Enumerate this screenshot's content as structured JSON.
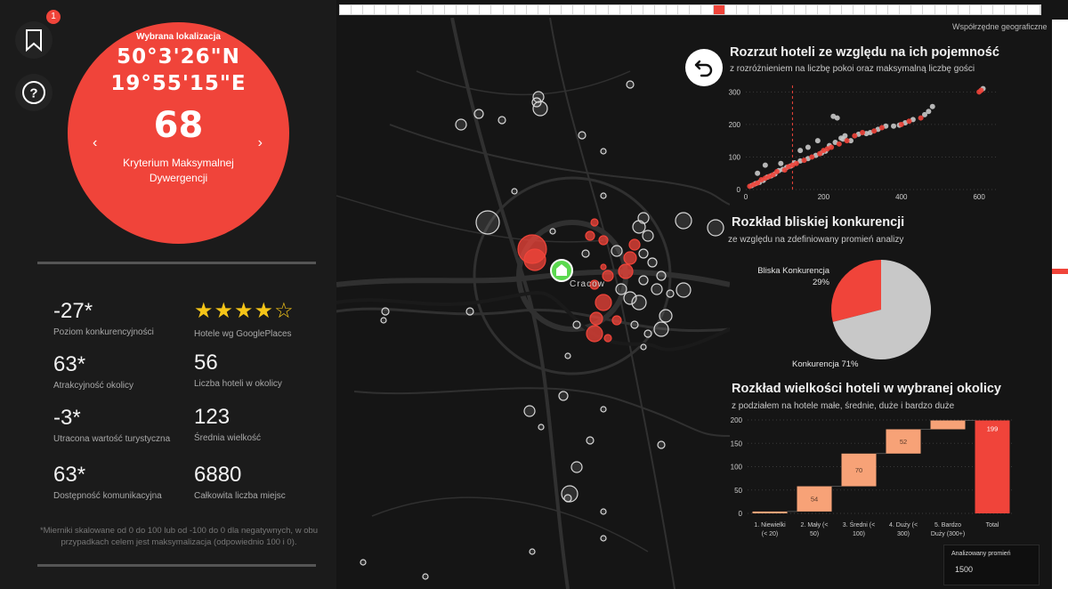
{
  "nav": {
    "badge_count": "1"
  },
  "location": {
    "label": "Wybrana lokalizacja",
    "lat": "50°3'26\"N",
    "lon": "19°55'15\"E",
    "score": "68",
    "criterion": "Kryterium Maksymalnej Dywergencji",
    "prev_icon": "‹",
    "next_icon": "›"
  },
  "kpis": [
    {
      "value": "-27*",
      "label": "Poziom konkurencyjności"
    },
    {
      "value": "63*",
      "label": "Atrakcyjność okolicy"
    },
    {
      "value": "-3*",
      "label": "Utracona wartość turystyczna"
    },
    {
      "value": "63*",
      "label": "Dostępność komunikacyjna"
    },
    {
      "value": "★★★★☆",
      "label": "Hotele wg GooglePlaces",
      "rating": 4,
      "max": 5
    },
    {
      "value": "56",
      "label": "Liczba hoteli w okolicy"
    },
    {
      "value": "123",
      "label": "Średnia wielkość"
    },
    {
      "value": "6880",
      "label": "Całkowita liczba miejsc"
    }
  ],
  "footnote": "*Mierniki skalowane od 0 do 100 lub od -100 do 0 dla negatywnych, w obu przypadkach celem jest maksymalizacja (odpowiednio 100 i 0).",
  "map": {
    "corner_label": "Współrzędne geograficzne",
    "city_label": "Cracow"
  },
  "colors": {
    "accent": "#f0443a",
    "light": "#c8c8c8",
    "peach": "#f7a277",
    "bg": "#151515"
  },
  "chart_data": [
    {
      "type": "scatter",
      "title": "Rozrzut hoteli ze względu na ich pojemność",
      "subtitle": "z rozróżnieniem na liczbę pokoi oraz maksymalną liczbę gości",
      "xlim": [
        0,
        650
      ],
      "ylim": [
        0,
        320
      ],
      "xticks": [
        0,
        200,
        400,
        600
      ],
      "yticks": [
        0,
        100,
        200,
        300
      ],
      "reference_x": 120,
      "series": [
        {
          "color": "#f0443a",
          "points": [
            [
              10,
              10
            ],
            [
              20,
              15
            ],
            [
              30,
              20
            ],
            [
              40,
              30
            ],
            [
              50,
              35
            ],
            [
              60,
              40
            ],
            [
              70,
              45
            ],
            [
              80,
              55
            ],
            [
              100,
              60
            ],
            [
              110,
              70
            ],
            [
              120,
              75
            ],
            [
              130,
              80
            ],
            [
              150,
              90
            ],
            [
              170,
              100
            ],
            [
              190,
              110
            ],
            [
              200,
              120
            ],
            [
              210,
              125
            ],
            [
              220,
              130
            ],
            [
              240,
              140
            ],
            [
              260,
              150
            ],
            [
              280,
              165
            ],
            [
              300,
              175
            ],
            [
              330,
              180
            ],
            [
              350,
              190
            ],
            [
              400,
              200
            ],
            [
              420,
              210
            ],
            [
              450,
              220
            ],
            [
              600,
              300
            ],
            [
              605,
              305
            ]
          ]
        },
        {
          "color": "#c8c8c8",
          "points": [
            [
              15,
              12
            ],
            [
              25,
              18
            ],
            [
              35,
              22
            ],
            [
              45,
              28
            ],
            [
              55,
              38
            ],
            [
              65,
              42
            ],
            [
              75,
              48
            ],
            [
              85,
              58
            ],
            [
              95,
              62
            ],
            [
              105,
              68
            ],
            [
              115,
              72
            ],
            [
              125,
              82
            ],
            [
              140,
              88
            ],
            [
              160,
              95
            ],
            [
              180,
              105
            ],
            [
              195,
              112
            ],
            [
              205,
              118
            ],
            [
              215,
              135
            ],
            [
              230,
              145
            ],
            [
              245,
              158
            ],
            [
              255,
              165
            ],
            [
              270,
              150
            ],
            [
              290,
              170
            ],
            [
              310,
              172
            ],
            [
              320,
              175
            ],
            [
              340,
              185
            ],
            [
              360,
              195
            ],
            [
              380,
              195
            ],
            [
              395,
              198
            ],
            [
              410,
              205
            ],
            [
              430,
              215
            ],
            [
              460,
              230
            ],
            [
              470,
              240
            ],
            [
              480,
              255
            ],
            [
              610,
              310
            ],
            [
              235,
              220
            ],
            [
              225,
              225
            ],
            [
              50,
              75
            ],
            [
              30,
              50
            ],
            [
              90,
              80
            ],
            [
              140,
              120
            ],
            [
              160,
              130
            ],
            [
              185,
              150
            ],
            [
              250,
              155
            ]
          ]
        }
      ]
    },
    {
      "type": "pie",
      "title": "Rozkład bliskiej konkurencji",
      "subtitle": "ze względu na zdefiniowany promień analizy",
      "slices": [
        {
          "label": "Bliska Konkurencja",
          "value": 29,
          "pct": "29%",
          "color": "#f0443a"
        },
        {
          "label": "Konkurencja",
          "value": 71,
          "pct": "71%",
          "color": "#c8c8c8"
        }
      ]
    },
    {
      "type": "bar",
      "subtitle_kind": "waterfall",
      "title": "Rozkład wielkości hoteli w wybranej okolicy",
      "subtitle": "z podziałem na hotele małe, średnie, duże i bardzo duże",
      "ylim": [
        0,
        200
      ],
      "yticks": [
        0,
        50,
        100,
        150,
        200
      ],
      "categories": [
        "1. Niewielki (< 20)",
        "2. Mały (< 50)",
        "3. Średni (< 100)",
        "4. Duży (< 300)",
        "5. Bardzo Duży (300+)",
        "Total"
      ],
      "category_lines": [
        [
          "1. Niewielki",
          "(< 20)"
        ],
        [
          "2. Mały (<",
          "50)"
        ],
        [
          "3. Średni (<",
          "100)"
        ],
        [
          "4. Duży (<",
          "300)"
        ],
        [
          "5. Bardzo",
          "Duży (300+)"
        ],
        [
          "Total"
        ]
      ],
      "values": [
        4,
        54,
        70,
        52,
        19,
        199
      ],
      "labels": [
        "",
        "54",
        "70",
        "52",
        "",
        "199"
      ]
    }
  ],
  "radius": {
    "label": "Analizowany promień",
    "value": "1500"
  }
}
